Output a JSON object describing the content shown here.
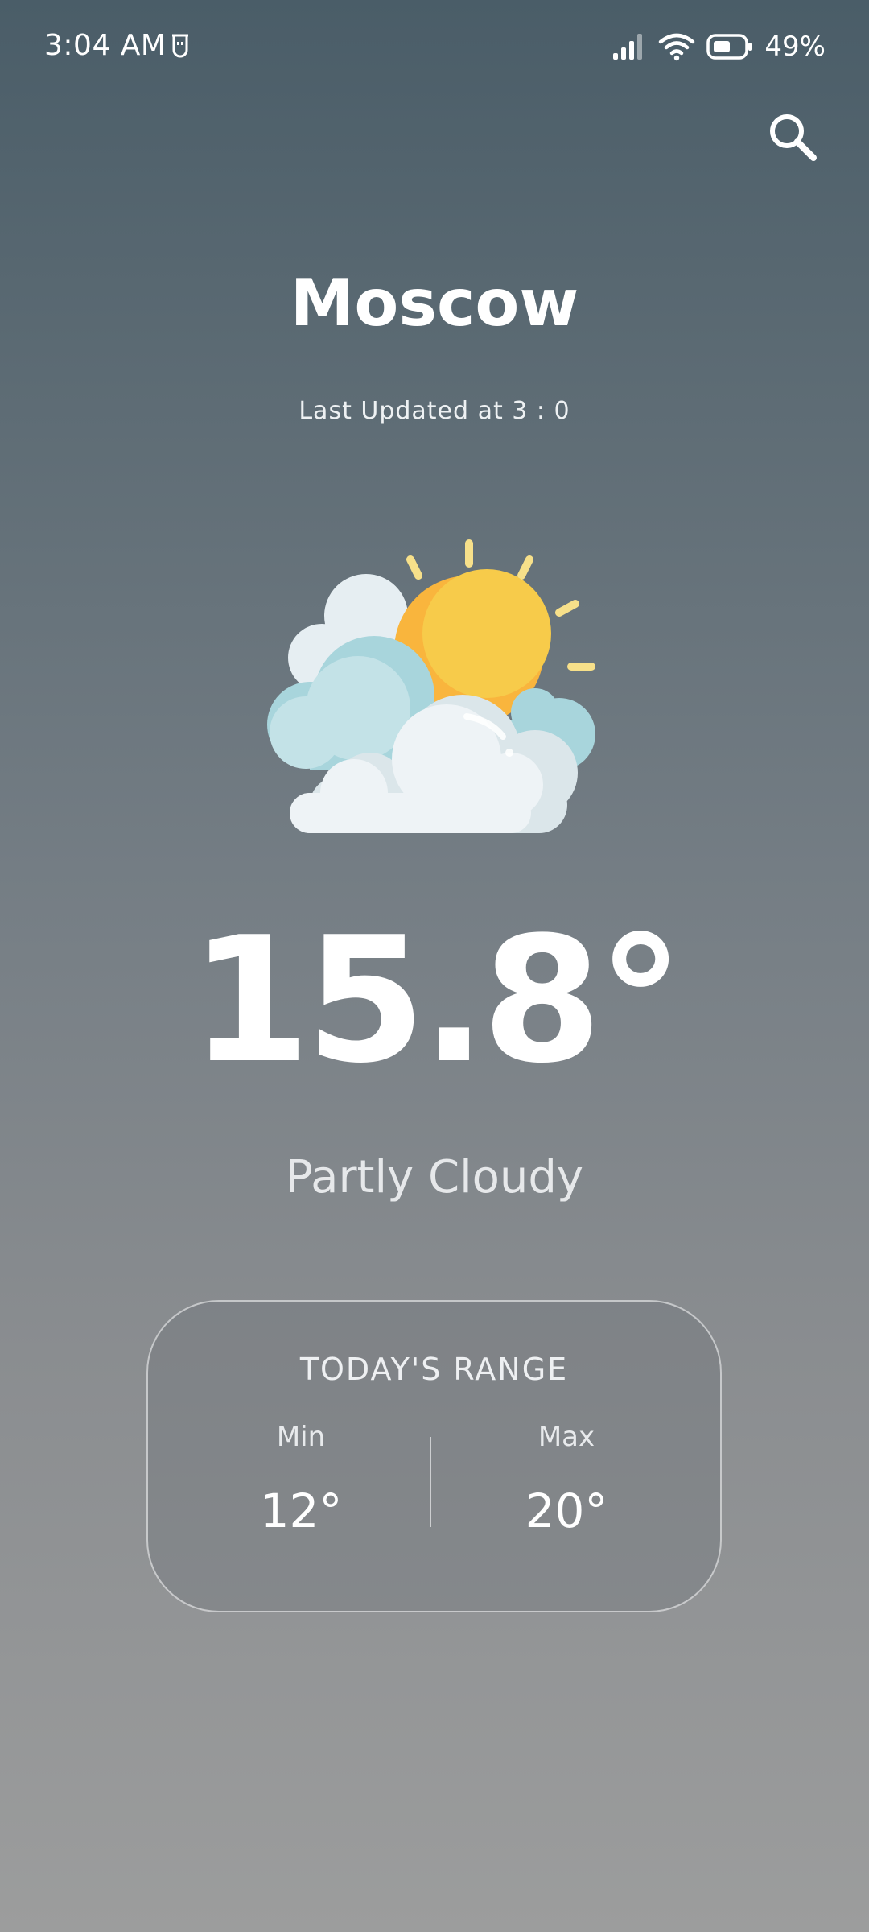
{
  "status_bar": {
    "time": "3:04 AM",
    "battery_percent": "49%",
    "icons": [
      "notification-icon",
      "signal-icon",
      "wifi-icon",
      "battery-icon"
    ]
  },
  "header": {
    "search_icon": "search-icon"
  },
  "location": {
    "city": "Moscow",
    "last_updated": "Last Updated at 3 : 0"
  },
  "current": {
    "icon": "partly-cloudy-icon",
    "temperature": "15.8°",
    "condition": "Partly Cloudy"
  },
  "range": {
    "title": "TODAY'S RANGE",
    "min_label": "Min",
    "min_value": "12°",
    "max_label": "Max",
    "max_value": "20°"
  },
  "colors": {
    "background_top": "#4a5d68",
    "background_bottom": "#9c9d9d",
    "sun": "#f9b53d",
    "sun_highlight": "#f7cb4a",
    "cloud_light": "#eef3f6",
    "cloud_blue": "#a8d5dc"
  }
}
